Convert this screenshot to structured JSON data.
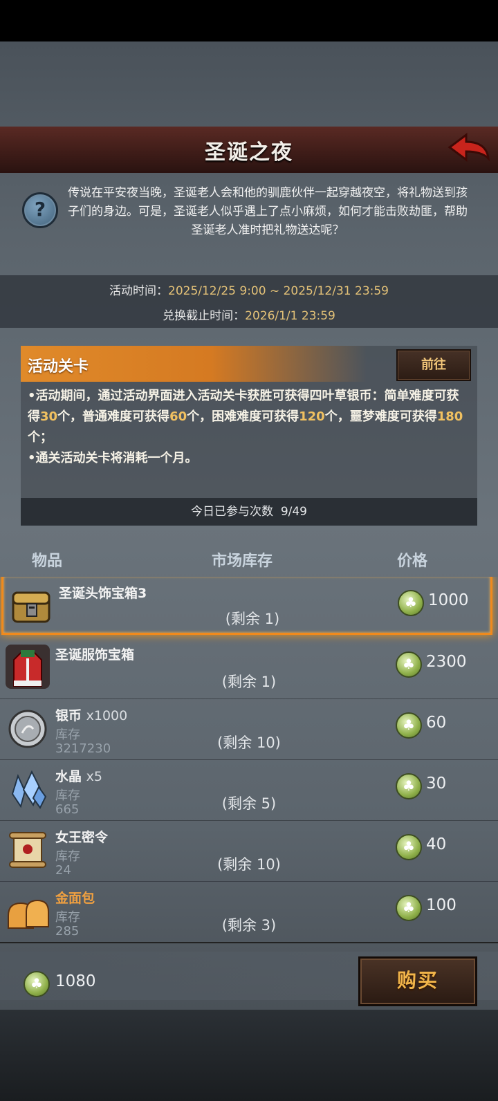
{
  "header": {
    "title": "圣诞之夜"
  },
  "description": "传说在平安夜当晚，圣诞老人会和他的驯鹿伙伴一起穿越夜空，将礼物送到孩子们的身边。可是，圣诞老人似乎遇上了点小麻烦，如何才能击败劫匪，帮助圣诞老人准时把礼物送达呢？",
  "times": {
    "event_label": "活动时间：",
    "event_value": "2025/12/25 9:00 ~ 2025/12/31 23:59",
    "exchange_label": "兑换截止时间：",
    "exchange_value": "2026/1/1 23:59"
  },
  "stage": {
    "title": "活动关卡",
    "go_label": "前往",
    "line1_a": "•活动期间，通过活动界面进入活动关卡获胜可获得四叶草银币：简单难度可获得",
    "n1": "30",
    "line1_b": "个，普通难度可获得",
    "n2": "60",
    "line1_c": "个，困难难度可获得",
    "n3": "120",
    "line1_d": "个，噩梦难度可获得",
    "n4": "180",
    "line1_e": "个；",
    "line2": "•通关活动关卡将消耗一个月。",
    "count_label": "今日已参与次数",
    "count_value": "9/49"
  },
  "list_headers": {
    "item": "物品",
    "stock": "市场库存",
    "price": "价格"
  },
  "items": [
    {
      "name": "圣诞头饰宝箱3",
      "qty": "",
      "stock_label": "",
      "stock": "",
      "remain": "(剩余 1)",
      "price": "1000",
      "icon": "helmet-chest-icon"
    },
    {
      "name": "圣诞服饰宝箱",
      "qty": "",
      "stock_label": "",
      "stock": "",
      "remain": "(剩余 1)",
      "price": "2300",
      "icon": "christmas-outfit-icon"
    },
    {
      "name": "银币",
      "qty": "x1000",
      "stock_label": "库存",
      "stock": "3217230",
      "remain": "(剩余 10)",
      "price": "60",
      "icon": "silver-coin-icon"
    },
    {
      "name": "水晶",
      "qty": "x5",
      "stock_label": "库存",
      "stock": "665",
      "remain": "(剩余 5)",
      "price": "30",
      "icon": "crystal-icon"
    },
    {
      "name": "女王密令",
      "qty": "",
      "stock_label": "库存",
      "stock": "24",
      "remain": "(剩余 10)",
      "price": "40",
      "icon": "scroll-icon"
    },
    {
      "name": "金面包",
      "qty": "",
      "stock_label": "库存",
      "stock": "285",
      "remain": "(剩余 3)",
      "price": "100",
      "icon": "bread-icon"
    }
  ],
  "footer": {
    "balance": "1080",
    "buy_label": "购买"
  },
  "colors": {
    "accent_orange": "#f08a1c",
    "gold_text": "#e4c278",
    "coin_green": "#8fb04a"
  }
}
